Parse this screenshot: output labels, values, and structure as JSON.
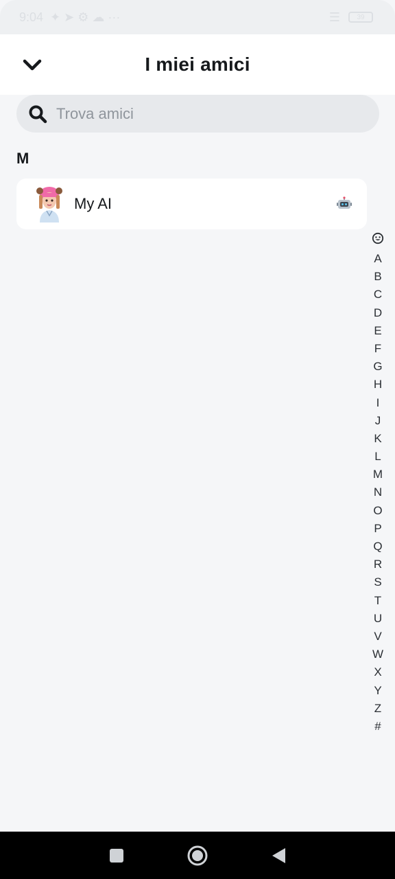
{
  "status_bar": {
    "time": "9:04",
    "battery": "39"
  },
  "header": {
    "title": "I miei amici",
    "back_icon": "chevron-down-icon"
  },
  "search": {
    "placeholder": "Trova amici",
    "value": ""
  },
  "sections": [
    {
      "letter": "M",
      "friends": [
        {
          "name": "My AI",
          "badge_icon": "robot-icon"
        }
      ]
    }
  ],
  "alphabet_index": [
    "A",
    "B",
    "C",
    "D",
    "E",
    "F",
    "G",
    "H",
    "I",
    "J",
    "K",
    "L",
    "M",
    "N",
    "O",
    "P",
    "Q",
    "R",
    "S",
    "T",
    "U",
    "V",
    "W",
    "X",
    "Y",
    "Z",
    "#"
  ],
  "colors": {
    "background": "#f5f6f8",
    "card": "#ffffff",
    "search_bg": "#e7e9ec",
    "text": "#16191c",
    "placeholder": "#8f959c"
  }
}
